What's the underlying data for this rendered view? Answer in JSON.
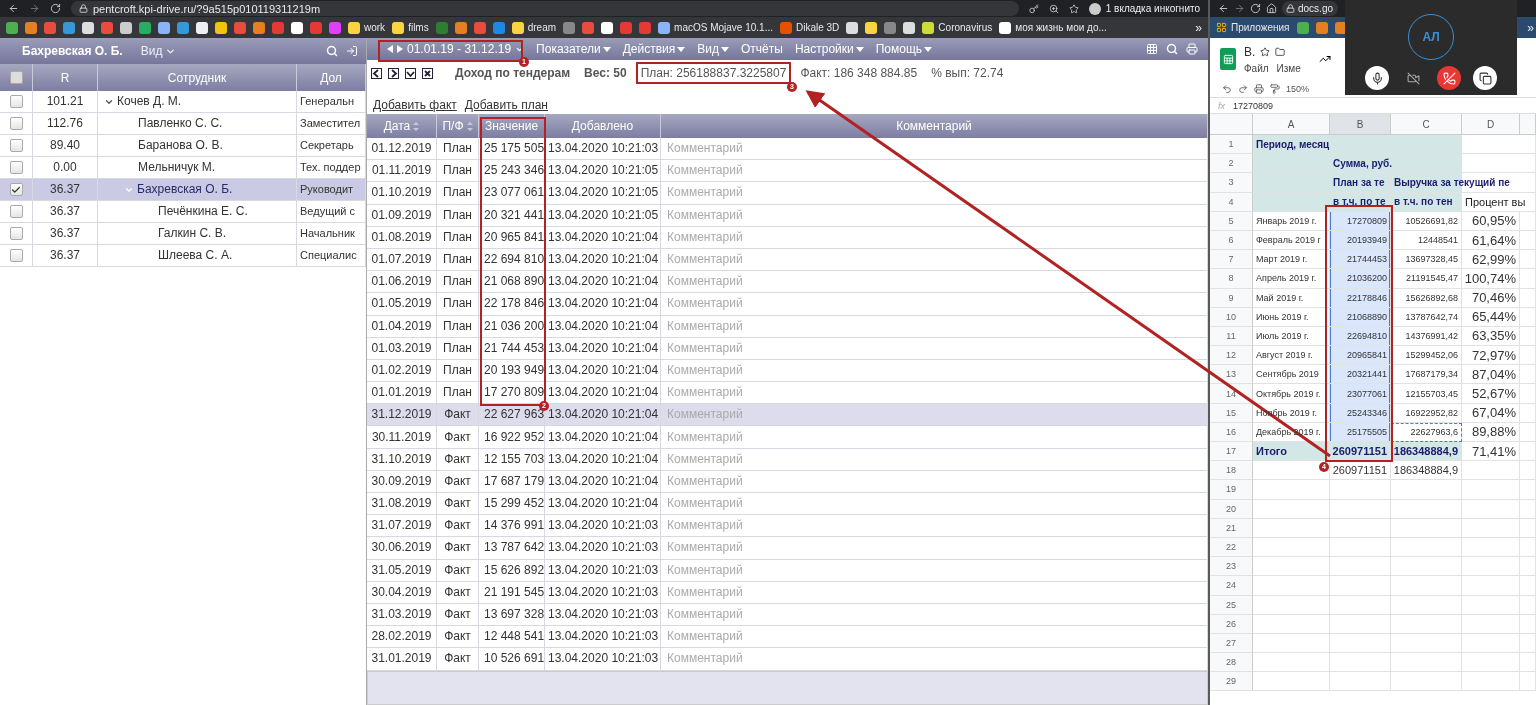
{
  "browser": {
    "url": "pentcroft.kpi-drive.ru/?9a515p010119311219m",
    "profile": "1 вкладка инкогнито",
    "more": "»",
    "bookmarks": [
      {
        "color": "#4caf50"
      },
      {
        "color": "#e67e22"
      },
      {
        "color": "#e74c3c"
      },
      {
        "color": "#3498db"
      },
      {
        "color": "#dddddd"
      },
      {
        "color": "#e74c3c"
      },
      {
        "color": "#cccccc"
      },
      {
        "color": "#27ae60"
      },
      {
        "color": "#8ab4f8"
      },
      {
        "color": "#3498db"
      },
      {
        "color": "#ecf0f1"
      },
      {
        "color": "#f1c40f"
      },
      {
        "color": "#e74c3c"
      },
      {
        "color": "#e67e22"
      },
      {
        "color": "#e53935"
      },
      {
        "color": "#ffffff"
      },
      {
        "color": "#e53935"
      },
      {
        "color": "#e040fb"
      },
      {
        "color": "#f9d342",
        "label": "work"
      },
      {
        "color": "#f9d342",
        "label": "films"
      },
      {
        "color": "#2e7d32"
      },
      {
        "color": "#e67e22"
      },
      {
        "color": "#e74c3c"
      },
      {
        "color": "#1e88e5"
      },
      {
        "color": "#f9d342",
        "label": "dream"
      },
      {
        "color": "#888888"
      },
      {
        "color": "#e74c3c"
      },
      {
        "color": "#ffffff"
      },
      {
        "color": "#e53935"
      },
      {
        "color": "#e53935"
      },
      {
        "color": "#8ab4f8",
        "label": "macOS Mojave 10.1..."
      },
      {
        "color": "#e65100",
        "label": "Dikale 3D"
      },
      {
        "color": "#dddddd"
      },
      {
        "color": "#f9d342"
      },
      {
        "color": "#888888"
      },
      {
        "color": "#dddddd"
      },
      {
        "color": "#cddc39",
        "label": "Coronavirus"
      },
      {
        "color": "#ffffff",
        "label": "моя жизнь мои до..."
      }
    ]
  },
  "employees_panel": {
    "title": "Бахревская О. Б.",
    "view": "Вид",
    "all_checked": false,
    "columns": [
      "R",
      "Сотрудник",
      "Дол"
    ],
    "employees": [
      {
        "r": "101.21",
        "name": "Кочев Д. М.",
        "position": "Генеральн",
        "checked": false,
        "selected": false,
        "expanded": true,
        "children": [
          {
            "r": "112.76",
            "name": "Павленко С. С.",
            "position": "Заместител",
            "checked": false,
            "selected": false
          },
          {
            "r": "89.40",
            "name": "Баранова О. В.",
            "position": "Секретарь",
            "checked": false,
            "selected": false
          },
          {
            "r": "0.00",
            "name": "Мельничук М.",
            "position": "Тех. поддер",
            "checked": false,
            "selected": false
          },
          {
            "r": "36.37",
            "name": "Бахревская О. Б.",
            "position": "Руководит",
            "checked": true,
            "selected": true,
            "expanded": true,
            "children": [
              {
                "r": "36.37",
                "name": "Печёнкина Е. С.",
                "position": "Ведущий с",
                "checked": false,
                "selected": false
              },
              {
                "r": "36.37",
                "name": "Галкин С. В.",
                "position": "Начальник",
                "checked": false,
                "selected": false
              },
              {
                "r": "36.37",
                "name": "Шлеева С. А.",
                "position": "Специалис",
                "checked": false,
                "selected": false
              }
            ]
          }
        ]
      }
    ]
  },
  "indicator_panel": {
    "period": "01.01.19 - 31.12.19",
    "menus": [
      {
        "label": "Показатели",
        "dropdown": true
      },
      {
        "label": "Действия",
        "dropdown": true
      },
      {
        "label": "Вид",
        "dropdown": true
      },
      {
        "label": "Отчёты",
        "dropdown": false
      },
      {
        "label": "Настройки",
        "dropdown": true
      },
      {
        "label": "Помощь",
        "dropdown": true
      }
    ],
    "indicator": "Доход по тендерам",
    "weight": "Вес: 50",
    "plan": "План: 256188837.3225807",
    "fact": "Факт: 186 348 884.85",
    "percent": "% вып: 72.74",
    "links": [
      "Добавить факт",
      "Добавить план"
    ],
    "columns": [
      {
        "label": "Дата",
        "sortable": true
      },
      {
        "label": "П/Ф",
        "sortable": true
      },
      {
        "label": "Значение",
        "sortable": false
      },
      {
        "label": "Добавлено",
        "sortable": false
      },
      {
        "label": "Комментарий",
        "sortable": false
      }
    ],
    "rows": [
      {
        "date": "01.12.2019",
        "type": "План",
        "value": "25 175 505",
        "added": "13.04.2020 10:21:03",
        "comment": "Комментарий",
        "selected": false
      },
      {
        "date": "01.11.2019",
        "type": "План",
        "value": "25 243 346",
        "added": "13.04.2020 10:21:05",
        "comment": "Комментарий",
        "selected": false
      },
      {
        "date": "01.10.2019",
        "type": "План",
        "value": "23 077 061",
        "added": "13.04.2020 10:21:05",
        "comment": "Комментарий",
        "selected": false
      },
      {
        "date": "01.09.2019",
        "type": "План",
        "value": "20 321 441",
        "added": "13.04.2020 10:21:05",
        "comment": "Комментарий",
        "selected": false
      },
      {
        "date": "01.08.2019",
        "type": "План",
        "value": "20 965 841",
        "added": "13.04.2020 10:21:04",
        "comment": "Комментарий",
        "selected": false
      },
      {
        "date": "01.07.2019",
        "type": "План",
        "value": "22 694 810",
        "added": "13.04.2020 10:21:04",
        "comment": "Комментарий",
        "selected": false
      },
      {
        "date": "01.06.2019",
        "type": "План",
        "value": "21 068 890",
        "added": "13.04.2020 10:21:04",
        "comment": "Комментарий",
        "selected": false
      },
      {
        "date": "01.05.2019",
        "type": "План",
        "value": "22 178 846",
        "added": "13.04.2020 10:21:04",
        "comment": "Комментарий",
        "selected": false
      },
      {
        "date": "01.04.2019",
        "type": "План",
        "value": "21 036 200",
        "added": "13.04.2020 10:21:04",
        "comment": "Комментарий",
        "selected": false
      },
      {
        "date": "01.03.2019",
        "type": "План",
        "value": "21 744 453",
        "added": "13.04.2020 10:21:04",
        "comment": "Комментарий",
        "selected": false
      },
      {
        "date": "01.02.2019",
        "type": "План",
        "value": "20 193 949",
        "added": "13.04.2020 10:21:04",
        "comment": "Комментарий",
        "selected": false
      },
      {
        "date": "01.01.2019",
        "type": "План",
        "value": "17 270 809",
        "added": "13.04.2020 10:21:04",
        "comment": "Комментарий",
        "selected": false
      },
      {
        "date": "31.12.2019",
        "type": "Факт",
        "value": "22 627 963",
        "added": "13.04.2020 10:21:04",
        "comment": "Комментарий",
        "selected": true
      },
      {
        "date": "30.11.2019",
        "type": "Факт",
        "value": "16 922 952",
        "added": "13.04.2020 10:21:04",
        "comment": "Комментарий",
        "selected": false
      },
      {
        "date": "31.10.2019",
        "type": "Факт",
        "value": "12 155 703",
        "added": "13.04.2020 10:21:04",
        "comment": "Комментарий",
        "selected": false
      },
      {
        "date": "30.09.2019",
        "type": "Факт",
        "value": "17 687 179",
        "added": "13.04.2020 10:21:04",
        "comment": "Комментарий",
        "selected": false
      },
      {
        "date": "31.08.2019",
        "type": "Факт",
        "value": "15 299 452",
        "added": "13.04.2020 10:21:04",
        "comment": "Комментарий",
        "selected": false
      },
      {
        "date": "31.07.2019",
        "type": "Факт",
        "value": "14 376 991",
        "added": "13.04.2020 10:21:03",
        "comment": "Комментарий",
        "selected": false
      },
      {
        "date": "30.06.2019",
        "type": "Факт",
        "value": "13 787 642",
        "added": "13.04.2020 10:21:03",
        "comment": "Комментарий",
        "selected": false
      },
      {
        "date": "31.05.2019",
        "type": "Факт",
        "value": "15 626 892",
        "added": "13.04.2020 10:21:03",
        "comment": "Комментарий",
        "selected": false
      },
      {
        "date": "30.04.2019",
        "type": "Факт",
        "value": "21 191 545",
        "added": "13.04.2020 10:21:03",
        "comment": "Комментарий",
        "selected": false
      },
      {
        "date": "31.03.2019",
        "type": "Факт",
        "value": "13 697 328",
        "added": "13.04.2020 10:21:03",
        "comment": "Комментарий",
        "selected": false
      },
      {
        "date": "28.02.2019",
        "type": "Факт",
        "value": "12 448 541",
        "added": "13.04.2020 10:21:03",
        "comment": "Комментарий",
        "selected": false
      },
      {
        "date": "31.01.2019",
        "type": "Факт",
        "value": "10 526 691",
        "added": "13.04.2020 10:21:03",
        "comment": "Комментарий",
        "selected": false
      }
    ]
  },
  "annotations": [
    {
      "number": "1"
    },
    {
      "number": "2"
    },
    {
      "number": "3"
    },
    {
      "number": "4"
    }
  ],
  "second_browser": {
    "url": "docs.go",
    "apps": "Приложения",
    "more": "»"
  },
  "sheet": {
    "title": "В.",
    "menu": [
      "Файл",
      "Изме"
    ],
    "zoom": "150%",
    "formula_label": "fx",
    "formula": "17270809",
    "columns": [
      "A",
      "B",
      "C",
      "D"
    ],
    "rows": [
      {
        "num": "1",
        "kind": "header",
        "cells": [
          {
            "text": "Период, месяц",
            "selected": false
          },
          {
            "selected": false
          },
          {
            "selected": false
          },
          {
            "selected": false
          }
        ]
      },
      {
        "num": "2",
        "kind": "header",
        "cells": [
          {
            "selected": false
          },
          {
            "text": "Сумма, руб.",
            "selected": false
          },
          {
            "selected": false
          },
          {
            "selected": false
          }
        ]
      },
      {
        "num": "3",
        "kind": "header",
        "cells": [
          {
            "selected": false
          },
          {
            "text": "План за те",
            "selected": false
          },
          {
            "text": "Выручка за текущий пе",
            "selected": false
          },
          {
            "selected": false
          }
        ]
      },
      {
        "num": "4",
        "kind": "header",
        "cells": [
          {
            "selected": false
          },
          {
            "text": "в т.ч. по те",
            "selected": false
          },
          {
            "text": "в т.ч. по тен",
            "selected": false
          },
          {
            "text": "Процент вы",
            "selected": false
          }
        ]
      },
      {
        "num": "5",
        "kind": "data",
        "cells": [
          {
            "text": "Январь 2019 г.",
            "selected": false
          },
          {
            "text": "17270809",
            "selected": true
          },
          {
            "text": "10526691,82",
            "selected": false
          },
          {
            "text": "60,95%",
            "selected": false
          }
        ]
      },
      {
        "num": "6",
        "kind": "data",
        "cells": [
          {
            "text": "Февраль 2019 г",
            "selected": false
          },
          {
            "text": "20193949",
            "selected": true
          },
          {
            "text": "12448541",
            "selected": false
          },
          {
            "text": "61,64%",
            "selected": false
          }
        ]
      },
      {
        "num": "7",
        "kind": "data",
        "cells": [
          {
            "text": "Март 2019 г.",
            "selected": false
          },
          {
            "text": "21744453",
            "selected": true
          },
          {
            "text": "13697328,45",
            "selected": false
          },
          {
            "text": "62,99%",
            "selected": false
          }
        ]
      },
      {
        "num": "8",
        "kind": "data",
        "cells": [
          {
            "text": "Апрель 2019 г.",
            "selected": false
          },
          {
            "text": "21036200",
            "selected": true
          },
          {
            "text": "21191545,47",
            "selected": false
          },
          {
            "text": "100,74%",
            "selected": false
          }
        ]
      },
      {
        "num": "9",
        "kind": "data",
        "cells": [
          {
            "text": "Май 2019 г.",
            "selected": false
          },
          {
            "text": "22178846",
            "selected": true
          },
          {
            "text": "15626892,68",
            "selected": false
          },
          {
            "text": "70,46%",
            "selected": false
          }
        ]
      },
      {
        "num": "10",
        "kind": "data",
        "cells": [
          {
            "text": "Июнь 2019 г.",
            "selected": false
          },
          {
            "text": "21068890",
            "selected": true
          },
          {
            "text": "13787642,74",
            "selected": false
          },
          {
            "text": "65,44%",
            "selected": false
          }
        ]
      },
      {
        "num": "11",
        "kind": "data",
        "cells": [
          {
            "text": "Июль 2019 г.",
            "selected": false
          },
          {
            "text": "22694810",
            "selected": true
          },
          {
            "text": "14376991,42",
            "selected": false
          },
          {
            "text": "63,35%",
            "selected": false
          }
        ]
      },
      {
        "num": "12",
        "kind": "data",
        "cells": [
          {
            "text": "Август 2019 г.",
            "selected": false
          },
          {
            "text": "20965841",
            "selected": true
          },
          {
            "text": "15299452,06",
            "selected": false
          },
          {
            "text": "72,97%",
            "selected": false
          }
        ]
      },
      {
        "num": "13",
        "kind": "data",
        "cells": [
          {
            "text": "Сентябрь 2019",
            "selected": false
          },
          {
            "text": "20321441",
            "selected": true
          },
          {
            "text": "17687179,34",
            "selected": false
          },
          {
            "text": "87,04%",
            "selected": false
          }
        ]
      },
      {
        "num": "14",
        "kind": "data",
        "cells": [
          {
            "text": "Октябрь 2019 г.",
            "selected": false
          },
          {
            "text": "23077061",
            "selected": true
          },
          {
            "text": "12155703,45",
            "selected": false
          },
          {
            "text": "52,67%",
            "selected": false
          }
        ]
      },
      {
        "num": "15",
        "kind": "data",
        "cells": [
          {
            "text": "Ноябрь 2019 г.",
            "selected": false
          },
          {
            "text": "25243346",
            "selected": true
          },
          {
            "text": "16922952,82",
            "selected": false
          },
          {
            "text": "67,04%",
            "selected": false
          }
        ]
      },
      {
        "num": "16",
        "kind": "data",
        "cells": [
          {
            "text": "Декабрь 2019 г.",
            "selected": false
          },
          {
            "text": "25175505",
            "selected": true
          },
          {
            "text": "22627963,6",
            "selected": false,
            "copied": true
          },
          {
            "text": "89,88%",
            "selected": false
          }
        ]
      },
      {
        "num": "17",
        "kind": "total",
        "cells": [
          {
            "text": "Итого",
            "selected": false
          },
          {
            "text": "260971151",
            "selected": false
          },
          {
            "text": "186348884,9",
            "selected": false
          },
          {
            "text": "71,41%",
            "selected": false
          }
        ]
      },
      {
        "num": "18",
        "kind": "plain",
        "cells": [
          {
            "selected": false
          },
          {
            "text": "260971151",
            "selected": false
          },
          {
            "text": "186348884,9",
            "selected": false
          },
          {
            "selected": false
          }
        ]
      },
      {
        "num": "19"
      },
      {
        "num": "20"
      },
      {
        "num": "21"
      },
      {
        "num": "22"
      },
      {
        "num": "23"
      },
      {
        "num": "24"
      },
      {
        "num": "25"
      },
      {
        "num": "26"
      },
      {
        "num": "27"
      },
      {
        "num": "28"
      },
      {
        "num": "29"
      }
    ]
  },
  "call": {
    "avatar": "АЛ",
    "controls": [
      {
        "kind": "mic"
      },
      {
        "kind": "camera-off"
      },
      {
        "kind": "hangup"
      },
      {
        "kind": "share"
      }
    ]
  }
}
